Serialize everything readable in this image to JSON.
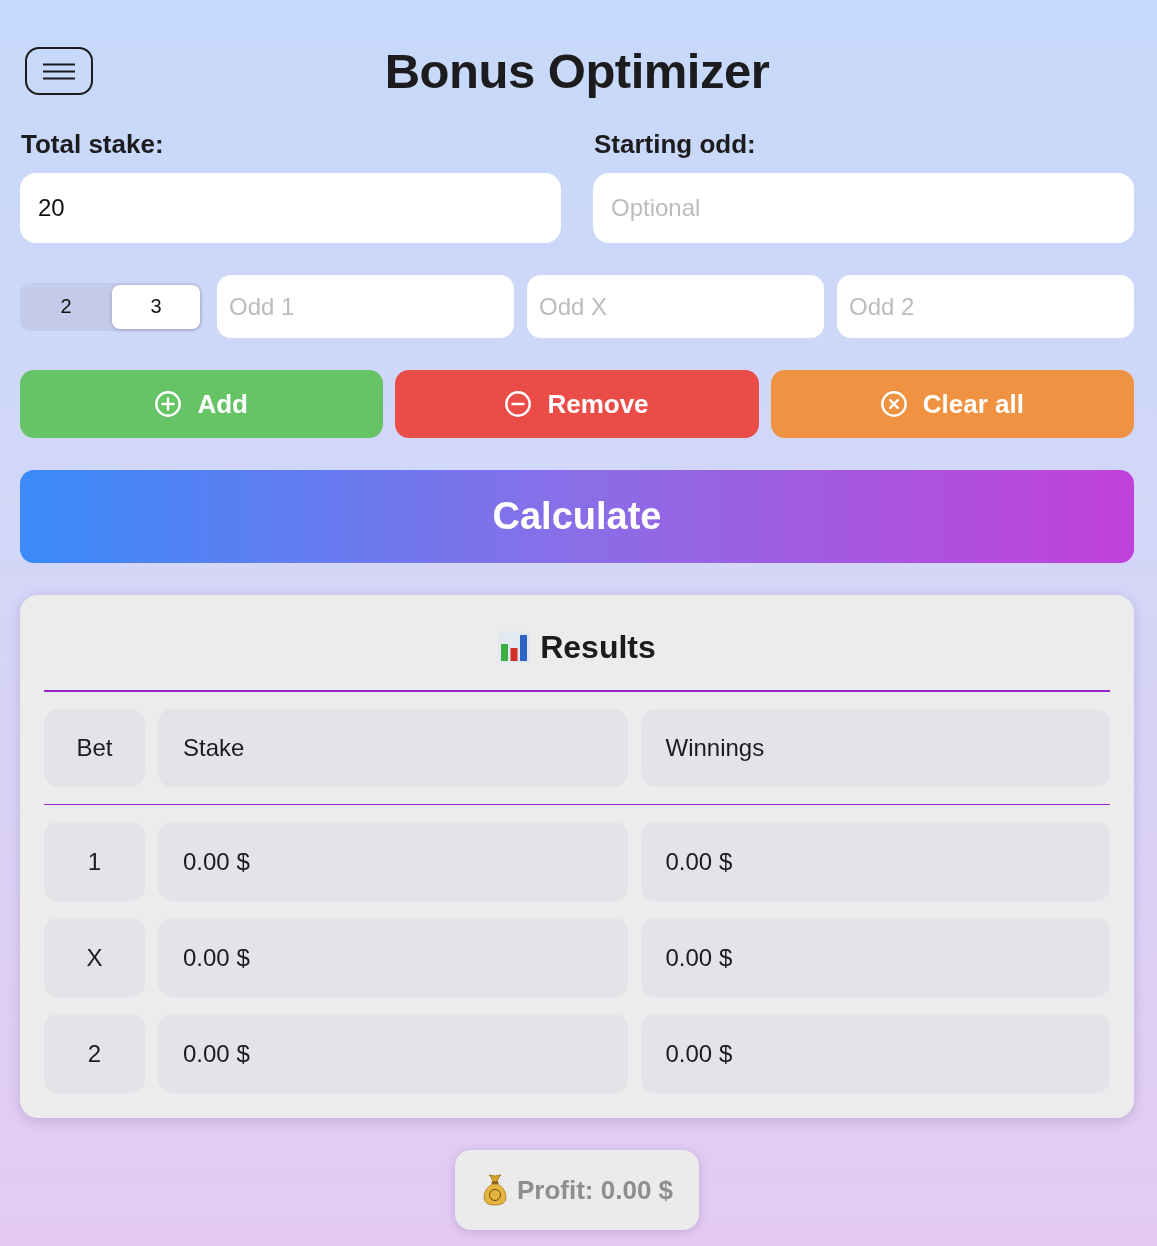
{
  "header": {
    "title": "Bonus Optimizer"
  },
  "inputs": [
    {
      "label": "Total stake:",
      "value": "20"
    },
    {
      "label": "Starting odd:",
      "placeholder": "Optional"
    }
  ],
  "outcome_count": {
    "options": [
      {
        "label": "2",
        "selected": false
      },
      {
        "label": "3",
        "selected": true
      }
    ]
  },
  "odds": [
    {
      "placeholder": "Odd 1"
    },
    {
      "placeholder": "Odd X"
    },
    {
      "placeholder": "Odd 2"
    }
  ],
  "actions": [
    {
      "label": "Add",
      "kind": "add"
    },
    {
      "label": "Remove",
      "kind": "remove"
    },
    {
      "label": "Clear all",
      "kind": "clear"
    }
  ],
  "calculate": {
    "label": "Calculate"
  },
  "results": {
    "title": "Results",
    "columns": [
      "Bet",
      "Stake",
      "Winnings"
    ],
    "rows": [
      [
        "1",
        "0.00 $",
        "0.00 $"
      ],
      [
        "X",
        "0.00 $",
        "0.00 $"
      ],
      [
        "2",
        "0.00 $",
        "0.00 $"
      ]
    ]
  },
  "profit": {
    "text": "Profit: 0.00 $"
  }
}
